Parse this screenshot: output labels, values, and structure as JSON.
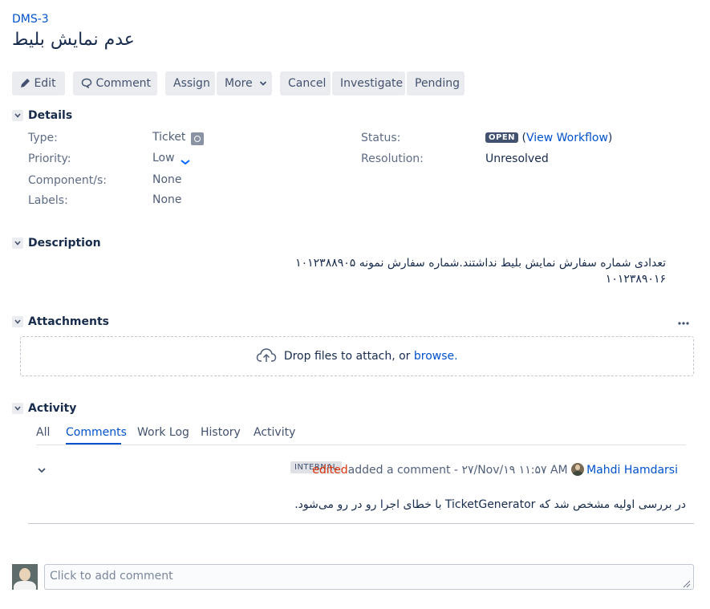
{
  "issue": {
    "key": "DMS-3",
    "title": "عدم نمایش بلیط"
  },
  "toolbar": {
    "edit": "Edit",
    "comment": "Comment",
    "assign": "Assign",
    "more": "More",
    "cancel": "Cancel",
    "investigate": "Investigate",
    "pending": "Pending"
  },
  "details": {
    "section_title": "Details",
    "type_label": "Type:",
    "type_value": "Ticket",
    "priority_label": "Priority:",
    "priority_value": "Low",
    "components_label": "Component/s:",
    "components_value": "None",
    "labels_label": "Labels:",
    "labels_value": "None",
    "status_label": "Status:",
    "status_value": "OPEN",
    "workflow_link": "View Workflow",
    "resolution_label": "Resolution:",
    "resolution_value": "Unresolved"
  },
  "description": {
    "section_title": "Description",
    "text": "تعدادی شماره سفارش نمایش بلیط نداشتند.شماره سفارش نمونه ۱۰۱۲۳۸۸۹۰۵ ۱۰۱۲۳۸۹۰۱۶"
  },
  "attachments": {
    "section_title": "Attachments",
    "drop_text": "Drop files to attach, or",
    "browse_link": "browse."
  },
  "activity": {
    "section_title": "Activity",
    "tabs": [
      "All",
      "Comments",
      "Work Log",
      "History",
      "Activity"
    ],
    "active_tab": "Comments",
    "comment": {
      "badge": "INTERNAL",
      "edited": "edited",
      "meta": "added a comment - ۲۷/Nov/۱۹ ۱۱:۵۷ AM",
      "author": "Mahdi Hamdarsi",
      "body": "در بررسی اولیه مشخص شد که TicketGenerator با خطای اجرا رو در رو می‌شود."
    }
  },
  "add_comment": {
    "placeholder": "Click to add comment"
  },
  "colors": {
    "link": "#0052cc",
    "button_bg": "#ebecf0",
    "status_bg": "#42526e",
    "edited": "#de350b"
  }
}
